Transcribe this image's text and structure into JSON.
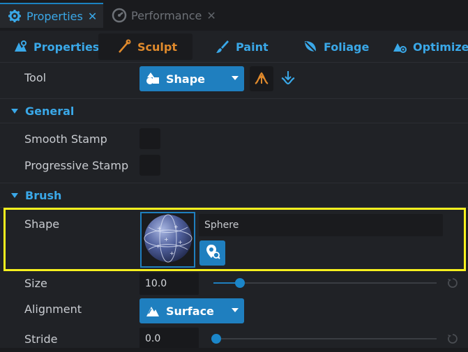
{
  "doc_tabs": [
    {
      "label": "Properties",
      "close": "✕",
      "icon": "gear-icon"
    },
    {
      "label": "Performance",
      "close": "✕",
      "icon": "speedometer-icon"
    }
  ],
  "mode_tabs": [
    {
      "label": "Properties",
      "icon": "properties-icon"
    },
    {
      "label": "Sculpt",
      "icon": "sculpt-brush-icon"
    },
    {
      "label": "Paint",
      "icon": "paint-brush-icon"
    },
    {
      "label": "Foliage",
      "icon": "leaf-icon"
    },
    {
      "label": "Optimize",
      "icon": "optimize-icon"
    }
  ],
  "tool": {
    "label": "Tool",
    "value": "Shape",
    "icon": "shape-icon",
    "raise_icon": "raise-icon",
    "lower_icon": "lower-icon"
  },
  "general": {
    "title": "General",
    "smooth_stamp": {
      "label": "Smooth Stamp",
      "checked": false
    },
    "progressive_stamp": {
      "label": "Progressive Stamp",
      "checked": false
    }
  },
  "brush": {
    "title": "Brush",
    "shape": {
      "label": "Shape",
      "name": "Sphere",
      "thumbnail": "sphere-icon",
      "picker_icon": "map-pin-search-icon"
    },
    "size": {
      "label": "Size",
      "value": "10.0",
      "slider_fraction": 0.12
    },
    "alignment": {
      "label": "Alignment",
      "value": "Surface",
      "icon": "mountain-icon"
    },
    "stride": {
      "label": "Stride",
      "value": "0.0",
      "slider_fraction": 0.0
    }
  },
  "colors": {
    "accent": "#1f7fbf",
    "accent_text": "#3aa8e8",
    "active_mode": "#e08a2c",
    "highlight": "#f6f01e",
    "background": "#202226"
  }
}
